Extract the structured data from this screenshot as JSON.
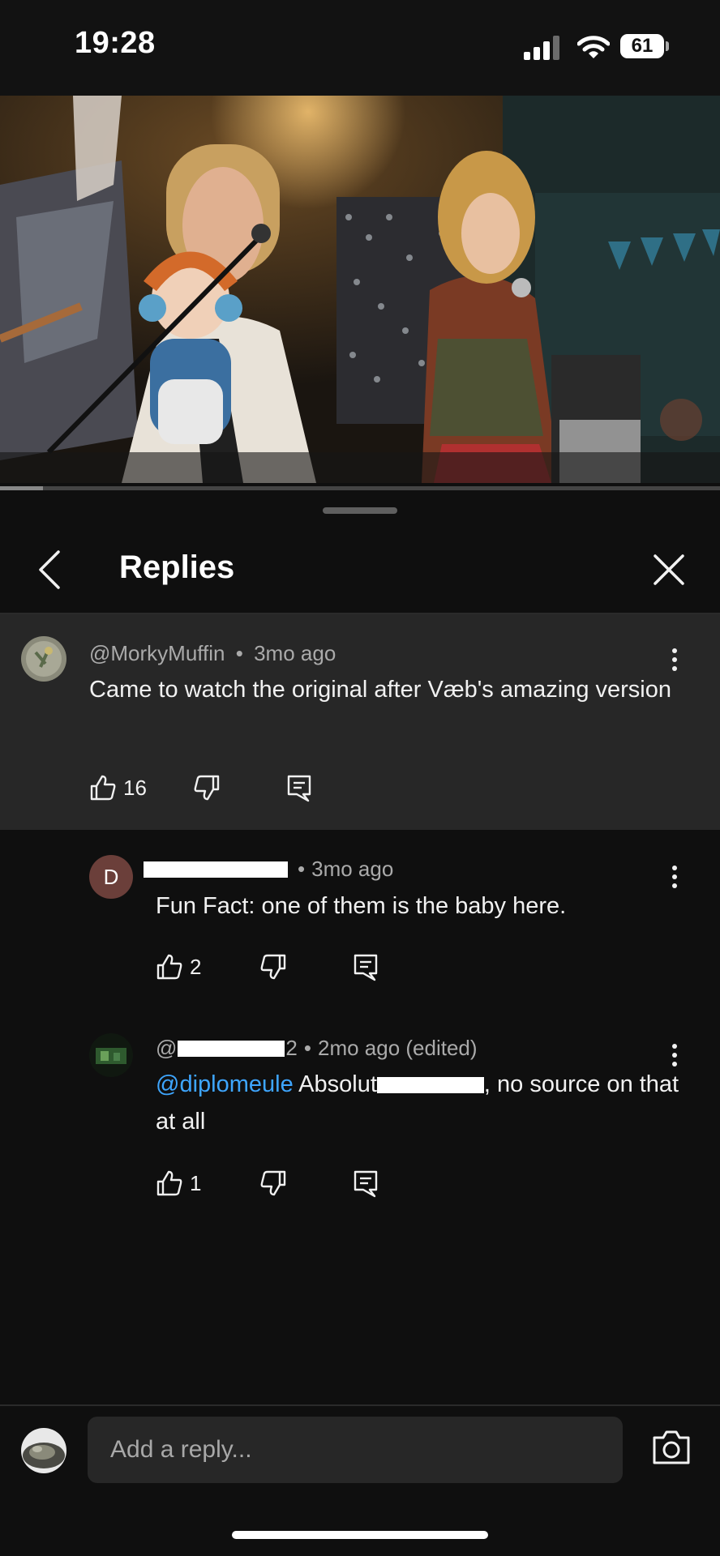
{
  "status_bar": {
    "time": "19:28",
    "battery": "61"
  },
  "video": {
    "progress": 0.06
  },
  "panel": {
    "title": "Replies"
  },
  "comments": [
    {
      "handle": "@MorkyMuffin",
      "age": "3mo ago",
      "text": "Came to watch the original after Væb's amazing version",
      "likes": "16"
    },
    {
      "avatar_letter": "D",
      "age": "3mo ago",
      "text": "Fun Fact: one of them is the baby here.",
      "likes": "2"
    },
    {
      "handle_prefix": "@",
      "handle_visible_end": "2",
      "age": "2mo ago (edited)",
      "mention": "@diplomeule",
      "text_before_redaction": "Absolut",
      "text_after_redaction": ", no source on that at all",
      "likes": "1"
    }
  ],
  "separator": "•",
  "reply_bar": {
    "placeholder": "Add a reply..."
  },
  "icons": [
    "back-chevron-icon",
    "close-icon",
    "more-vert-icon",
    "thumb-up-icon",
    "thumb-down-icon",
    "reply-comment-icon",
    "camera-icon",
    "cellular-signal-icon",
    "wifi-icon",
    "battery-icon"
  ],
  "colors": {
    "background": "#0f0f0f",
    "highlight": "#272727",
    "mention": "#3ea6ff",
    "meta": "#aaaaaa"
  }
}
